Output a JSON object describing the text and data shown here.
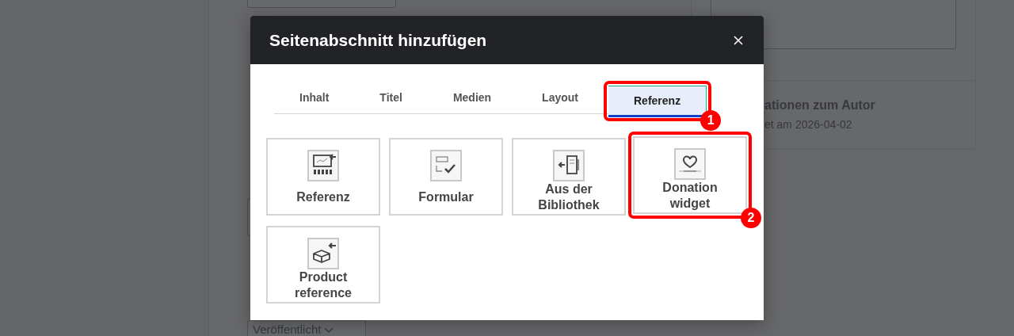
{
  "background": {
    "status_select": {
      "value": "Veröffentlicht"
    },
    "author_panel": {
      "heading": "ationen zum Autor",
      "date": "et am 2026-04-02"
    }
  },
  "dialog": {
    "title": "Seitenabschnitt hinzufügen",
    "tabs": [
      {
        "label": "Inhalt",
        "selected": false
      },
      {
        "label": "Titel",
        "selected": false
      },
      {
        "label": "Medien",
        "selected": false
      },
      {
        "label": "Layout",
        "selected": false
      },
      {
        "label": "Referenz",
        "selected": true,
        "callout": "1"
      }
    ],
    "items": [
      {
        "label": "Referenz",
        "kind": "reference"
      },
      {
        "label": "Formular",
        "kind": "form"
      },
      {
        "label": "Aus der Bibliothek",
        "kind": "library"
      },
      {
        "label": "Donation widget",
        "kind": "donation",
        "callout": "2"
      },
      {
        "label": "Product reference",
        "kind": "product"
      }
    ]
  }
}
